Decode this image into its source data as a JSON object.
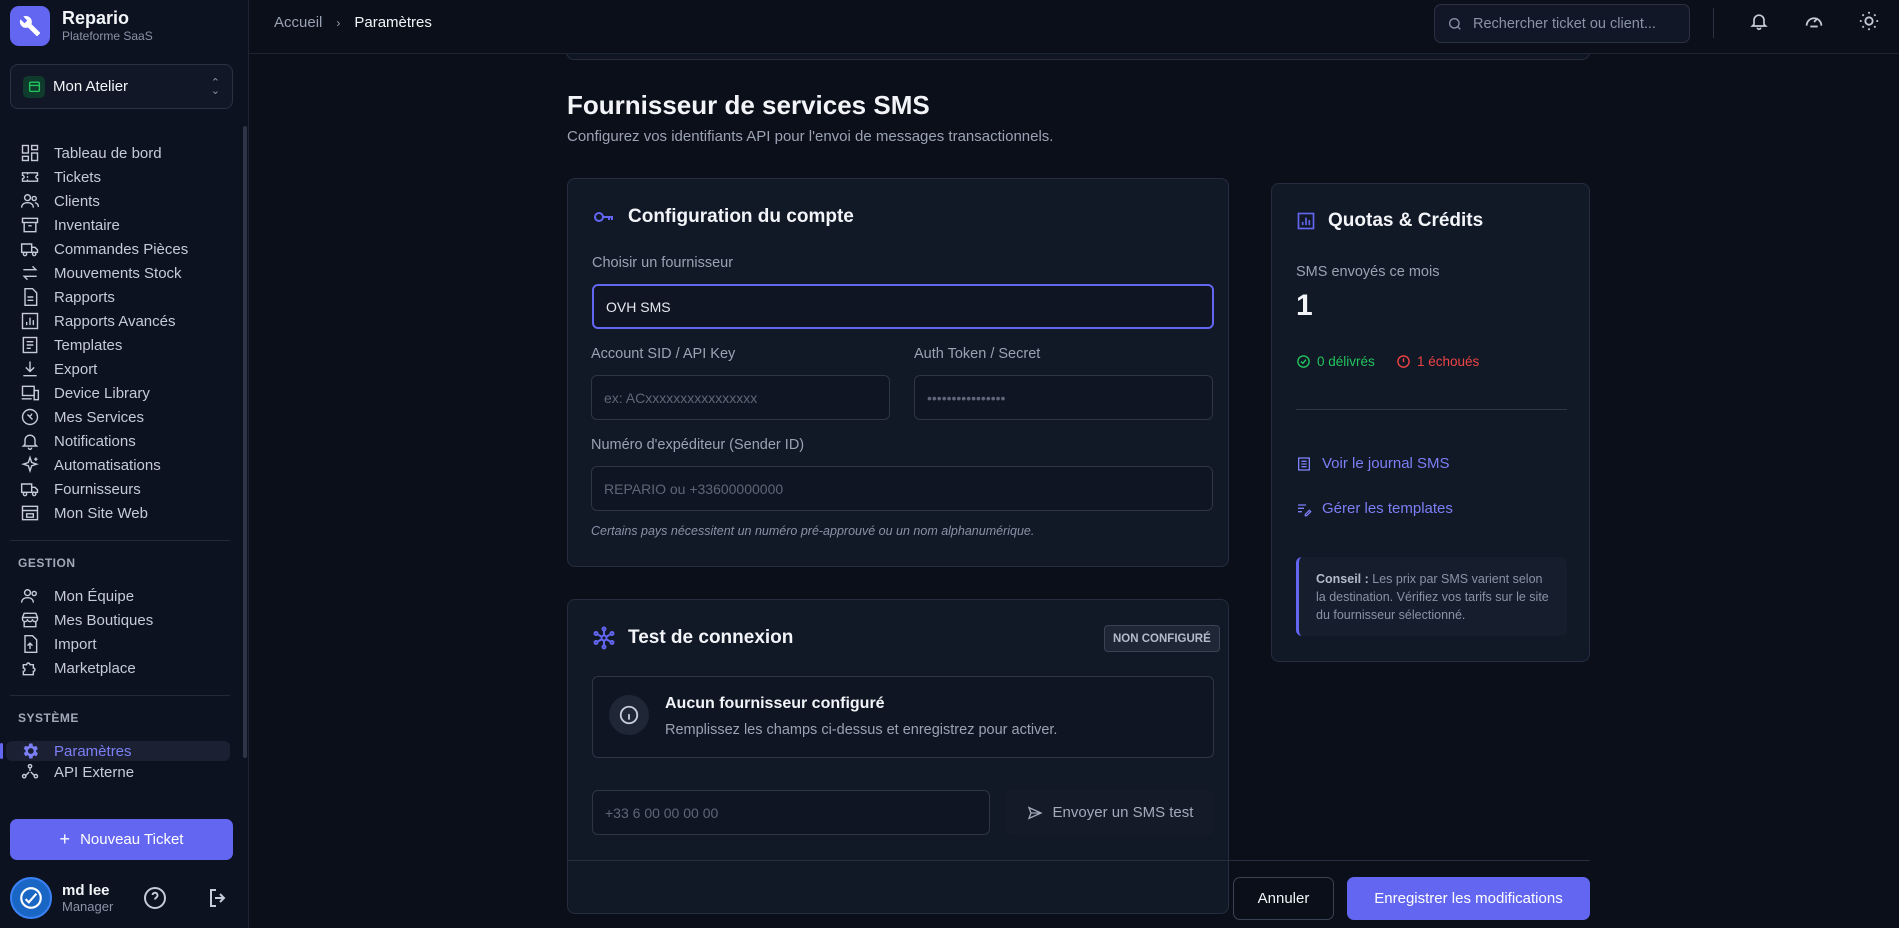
{
  "brand": {
    "name": "Repario",
    "subtitle": "Plateforme SaaS"
  },
  "workspace": {
    "label": "Mon Atelier"
  },
  "nav": {
    "main": [
      {
        "label": "Tableau de bord",
        "icon": "dashboard-icon"
      },
      {
        "label": "Tickets",
        "icon": "ticket-icon"
      },
      {
        "label": "Clients",
        "icon": "users-icon"
      },
      {
        "label": "Inventaire",
        "icon": "archive-icon"
      },
      {
        "label": "Commandes Pièces",
        "icon": "truck-icon"
      },
      {
        "label": "Mouvements Stock",
        "icon": "arrows-icon"
      },
      {
        "label": "Rapports",
        "icon": "document-icon"
      },
      {
        "label": "Rapports Avancés",
        "icon": "chart-icon"
      },
      {
        "label": "Templates",
        "icon": "template-icon"
      },
      {
        "label": "Export",
        "icon": "download-icon"
      },
      {
        "label": "Device Library",
        "icon": "devices-icon"
      },
      {
        "label": "Mes Services",
        "icon": "wrench-icon"
      },
      {
        "label": "Notifications",
        "icon": "bell-icon"
      },
      {
        "label": "Automatisations",
        "icon": "sparkles-icon"
      },
      {
        "label": "Fournisseurs",
        "icon": "truck-icon"
      },
      {
        "label": "Mon Site Web",
        "icon": "website-icon"
      }
    ],
    "gestion_title": "GESTION",
    "gestion": [
      {
        "label": "Mon Équipe",
        "icon": "team-icon"
      },
      {
        "label": "Mes Boutiques",
        "icon": "store-icon"
      },
      {
        "label": "Import",
        "icon": "upload-icon"
      },
      {
        "label": "Marketplace",
        "icon": "puzzle-icon"
      }
    ],
    "systeme_title": "SYSTÈME",
    "systeme": [
      {
        "label": "Paramètres",
        "icon": "gear-icon"
      },
      {
        "label": "API Externe",
        "icon": "api-icon"
      }
    ]
  },
  "new_ticket_label": "Nouveau Ticket",
  "user": {
    "name": "md lee",
    "role": "Manager"
  },
  "breadcrumb": {
    "home": "Accueil",
    "current": "Paramètres"
  },
  "search": {
    "placeholder": "Rechercher ticket ou client..."
  },
  "page": {
    "title": "Fournisseur de services SMS",
    "subtitle": "Configurez vos identifiants API pour l'envoi de messages transactionnels."
  },
  "config": {
    "title": "Configuration du compte",
    "provider_label": "Choisir un fournisseur",
    "provider_value": "OVH SMS",
    "sid_label": "Account SID / API Key",
    "sid_placeholder": "ex: ACxxxxxxxxxxxxxxxx",
    "token_label": "Auth Token / Secret",
    "token_placeholder": "••••••••••••••••",
    "sender_label": "Numéro d'expéditeur (Sender ID)",
    "sender_placeholder": "REPARIO ou +33600000000",
    "hint": "Certains pays nécessitent un numéro pré-approuvé ou un nom alphanumérique."
  },
  "test": {
    "title": "Test de connexion",
    "badge": "NON CONFIGURÉ",
    "info_title": "Aucun fournisseur configuré",
    "info_text": "Remplissez les champs ci-dessus et enregistrez pour activer.",
    "phone_placeholder": "+33 6 00 00 00 00",
    "send_label": "Envoyer un SMS test"
  },
  "quotas": {
    "title": "Quotas & Crédits",
    "sent_label": "SMS envoyés ce mois",
    "sent_value": "1",
    "delivered": "0 délivrés",
    "failed": "1 échoués",
    "link_journal": "Voir le journal SMS",
    "link_templates": "Gérer les templates",
    "tip_bold": "Conseil :",
    "tip_text": " Les prix par SMS varient selon la destination. Vérifiez vos tarifs sur le site du fournisseur sélectionné."
  },
  "actions": {
    "cancel": "Annuler",
    "save": "Enregistrer les modifications"
  },
  "colors": {
    "accent": "#6366f1",
    "success": "#22c55e",
    "danger": "#ef4444",
    "background": "#0b0f19"
  }
}
